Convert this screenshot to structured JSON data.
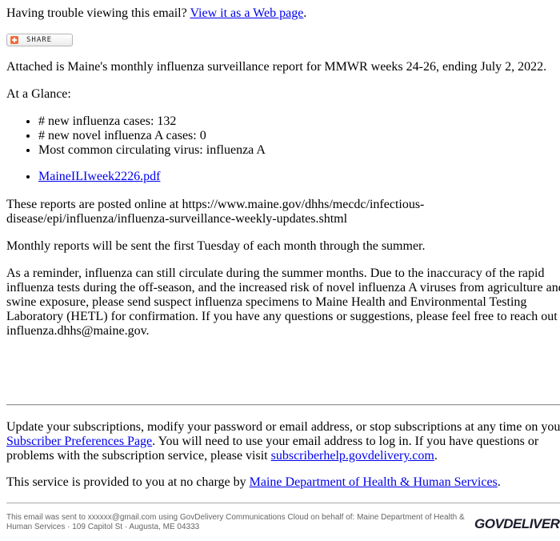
{
  "header": {
    "trouble_text": "Having trouble viewing this email? ",
    "web_link": "View it as a Web page",
    "trouble_suffix": "."
  },
  "share": {
    "label": "SHARE",
    "icon": "plus-icon",
    "icon_color": "#f26b3a"
  },
  "body": {
    "intro": "Attached is Maine's monthly influenza surveillance report for MMWR weeks 24-26, ending July 2, 2022.",
    "glance_heading": "At a Glance:",
    "glance_items": [
      "# new influenza cases: 132",
      "# new novel influenza A cases: 0",
      "Most common circulating virus: influenza A"
    ],
    "attachment": "MaineILIweek2226.pdf",
    "posted": "These reports are posted online at https://www.maine.gov/dhhs/mecdc/infectious-disease/epi/influenza/influenza-surveillance-weekly-updates.shtml",
    "monthly": "Monthly reports will be sent the first Tuesday of each month through the summer.",
    "reminder": "As a reminder, influenza can still circulate during the summer months. Due to the inaccuracy of the rapid influenza tests during the off-season, and the increased risk of novel influenza A viruses from agriculture and swine exposure, please send suspect influenza specimens to Maine Health and Environmental Testing Laboratory (HETL) for confirmation. If you have any questions or suggestions, please feel free to reach out to influenza.dhhs@maine.gov."
  },
  "subscription": {
    "text1": "Update your subscriptions, modify your password or email address, or stop subscriptions at any time on your ",
    "prefs_link": "Subscriber Preferences Page",
    "text2": ". You will need to use your email address to log in. If you have questions or problems with the subscription service, please visit ",
    "help_link": "subscriberhelp.govdelivery.com",
    "text3": "."
  },
  "service": {
    "text": "This service is provided to you at no charge by ",
    "link": "Maine Department of Health & Human Services",
    "suffix": "."
  },
  "footer": {
    "text": "This email was sent to xxxxxx@gmail.com using GovDelivery Communications Cloud on behalf of: Maine Department of Health & Human Services · 109 Capitol St · Augusta, ME 04333",
    "logo": "GOVDELIVERY",
    "logo_mark": "»"
  },
  "colors": {
    "link": "#0000ee",
    "footer_text": "#666666"
  }
}
